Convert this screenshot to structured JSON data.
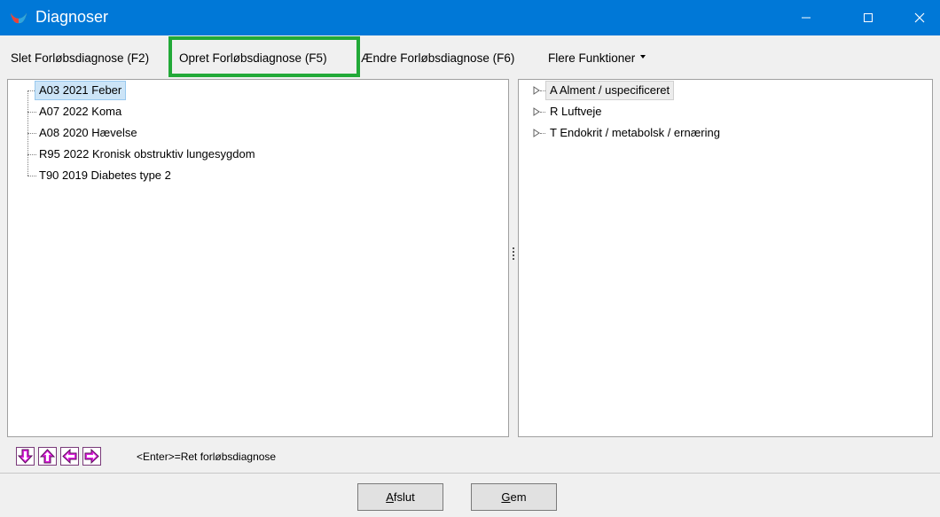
{
  "window": {
    "title": "Diagnoser"
  },
  "toolbar": {
    "items": [
      {
        "label": "Slet Forløbsdiagnose (F2)"
      },
      {
        "label": "Opret Forløbsdiagnose (F5)"
      },
      {
        "label": "Ændre Forløbsdiagnose (F6)"
      },
      {
        "label": "Flere Funktioner"
      }
    ]
  },
  "left_tree": {
    "items": [
      {
        "label": "A03 2021 Feber",
        "selected": true
      },
      {
        "label": "A07 2022 Koma",
        "selected": false
      },
      {
        "label": "A08 2020 Hævelse",
        "selected": false
      },
      {
        "label": "R95 2022 Kronisk obstruktiv lungesygdom",
        "selected": false
      },
      {
        "label": "T90 2019 Diabetes type 2",
        "selected": false
      }
    ]
  },
  "right_tree": {
    "items": [
      {
        "label": "A Alment / uspecificeret",
        "selected": true
      },
      {
        "label": "R Luftveje",
        "selected": false
      },
      {
        "label": "T Endokrit / metabolsk / ernæring",
        "selected": false
      }
    ]
  },
  "status": {
    "hint": "<Enter>=Ret forløbsdiagnose",
    "nav_icons": [
      "arrow-down-icon",
      "arrow-up-icon",
      "arrow-left-icon",
      "arrow-right-icon"
    ]
  },
  "buttons": {
    "close_mnemonic": "A",
    "close_rest": "fslut",
    "save_mnemonic": "G",
    "save_rest": "em"
  },
  "colors": {
    "titlebar": "#0078d7",
    "highlight_border": "#22a938",
    "selection": "#cce4f7",
    "nav_arrow": "#e020e0"
  }
}
